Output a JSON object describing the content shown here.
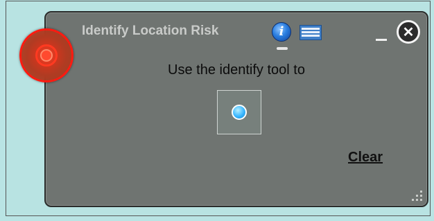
{
  "widget": {
    "title": "Identify Location Risk",
    "instruction": "Use the identify tool to",
    "clear_label": "Clear",
    "info_icon_glyph": "i",
    "close_icon_glyph": "✕"
  },
  "icons": {
    "info": "info-icon",
    "table": "table-icon",
    "minimize": "minimize-icon",
    "close": "close-icon",
    "tool": "identify-point-icon",
    "resize": "resize-grip-icon",
    "marker": "location-marker-icon"
  },
  "colors": {
    "background": "#b9e4e4",
    "panel": "#6f7471",
    "title_text": "#c9cbc9",
    "marker_red": "#ff1a10",
    "tool_dot_blue": "#38b6ff"
  }
}
